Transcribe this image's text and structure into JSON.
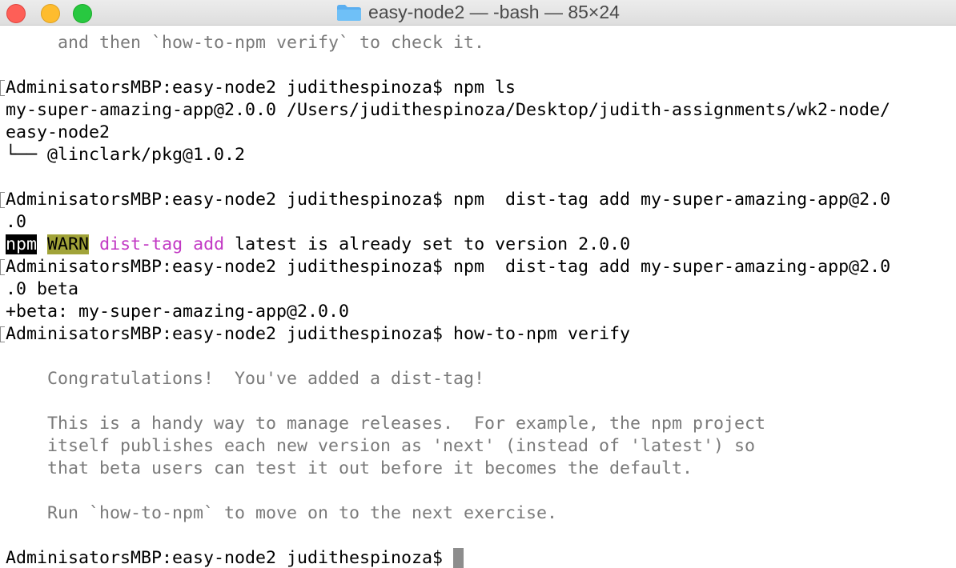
{
  "window": {
    "title": "easy-node2 — -bash — 85×24"
  },
  "terminal": {
    "prompt": "AdminisatorsMBP:easy-node2 judithespinoza$",
    "intro_line": "     and then `how-to-npm verify` to check it.",
    "cmd_ls": "npm ls",
    "ls_out_1": "my-super-amazing-app@2.0.0 /Users/judithespinoza/Desktop/judith-assignments/wk2-node/",
    "ls_out_2": "easy-node2",
    "ls_out_3": "└── @linclark/pkg@1.0.2",
    "cmd_disttag_1": "npm  dist-tag add my-super-amazing-app@2.0",
    "cmd_disttag_1_wrap": ".0",
    "warn_npm": "npm",
    "warn_label": "WARN",
    "warn_cmd": "dist-tag add",
    "warn_msg": "latest is already set to version 2.0.0",
    "cmd_disttag_2": "npm  dist-tag add my-super-amazing-app@2.0",
    "cmd_disttag_2_wrap": ".0 beta",
    "beta_out": "+beta: my-super-amazing-app@2.0.0",
    "cmd_verify": "how-to-npm verify",
    "congrats": "    Congratulations!  You've added a dist-tag!",
    "para_1": "    This is a handy way to manage releases.  For example, the npm project",
    "para_2": "    itself publishes each new version as 'next' (instead of 'latest') so",
    "para_3": "    that beta users can test it out before it becomes the default.",
    "run_next": "    Run `how-to-npm` to move on to the next exercise."
  },
  "icons": {
    "folder": "folder-icon",
    "folder_color": "#5aaef0"
  },
  "colors": {
    "warn_bg": "#a1a339",
    "magenta": "#c23ac4",
    "close": "#fe5f57",
    "minimize": "#febc2e",
    "maximize": "#28c840"
  }
}
